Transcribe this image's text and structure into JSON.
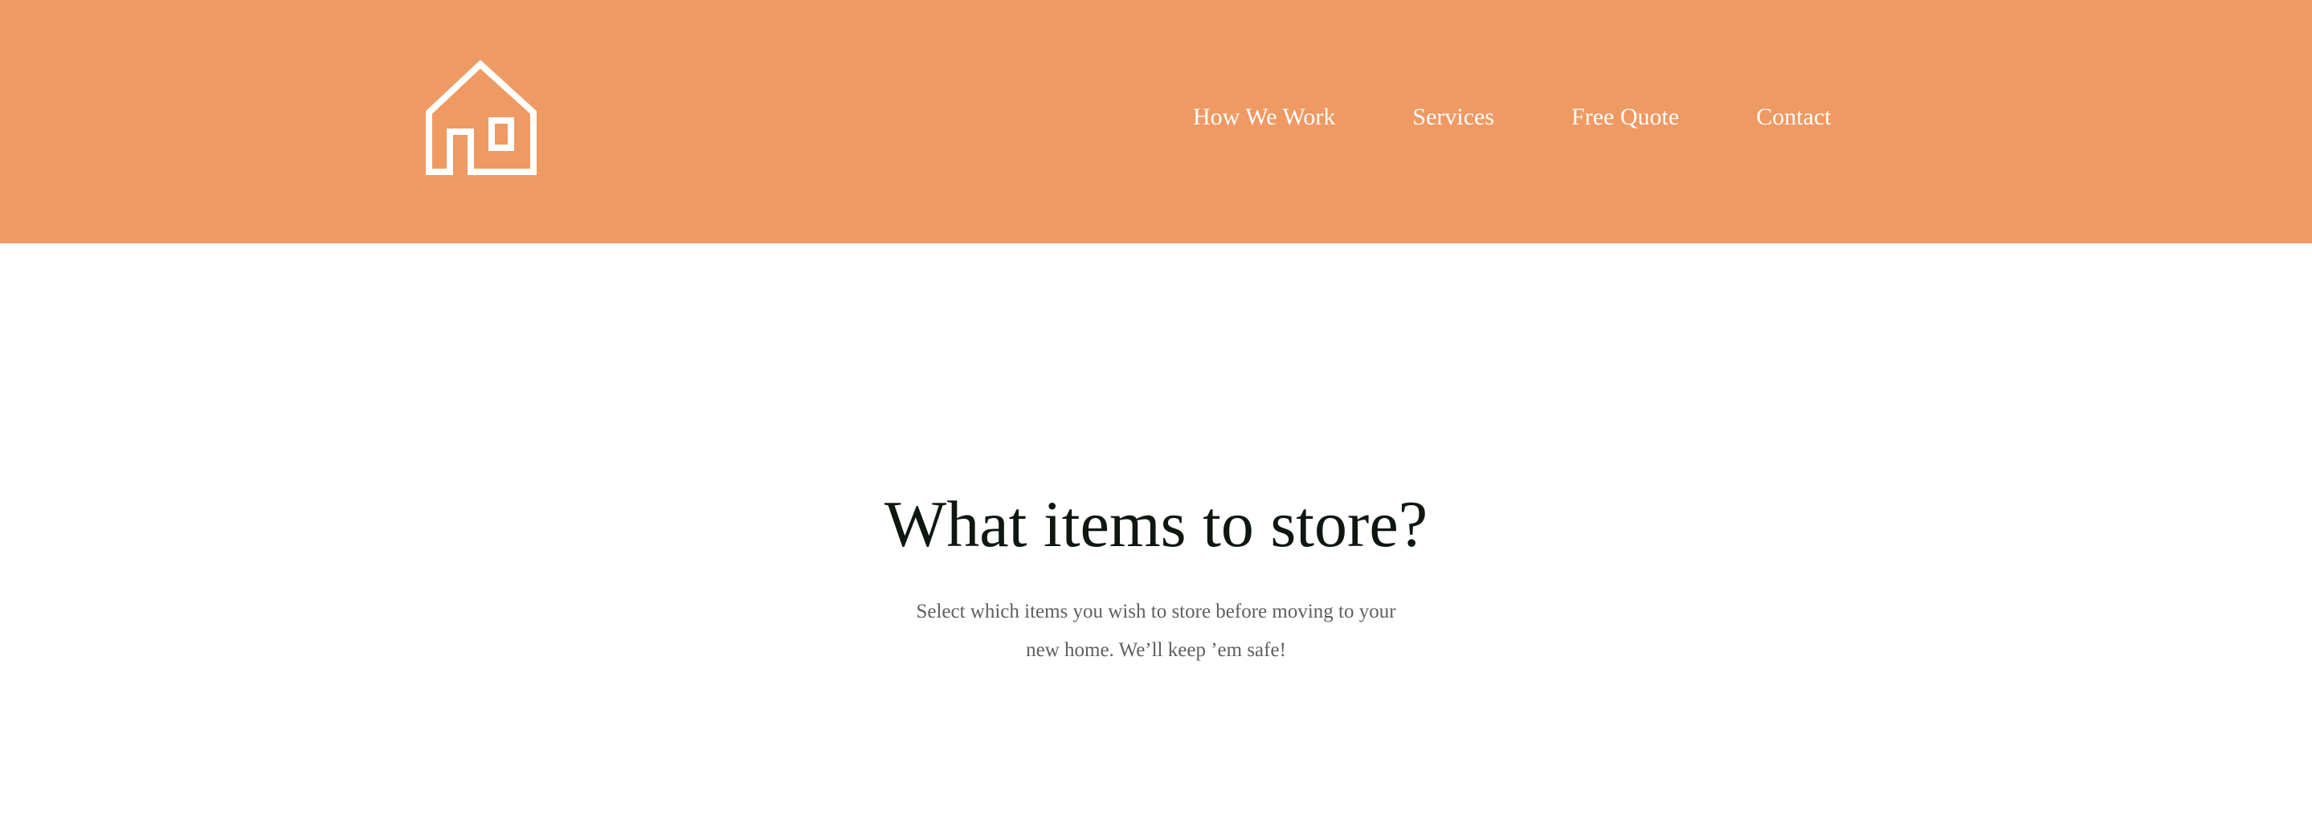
{
  "header": {
    "background_color": "#ef9963",
    "logo": {
      "icon": "house-icon"
    },
    "nav": [
      {
        "label": "How We Work"
      },
      {
        "label": "Services"
      },
      {
        "label": "Free Quote"
      },
      {
        "label": "Contact"
      }
    ]
  },
  "hero": {
    "title": "What items to store?",
    "subtitle": "Select which items you wish to store before moving to your new home. We’ll keep ’em safe!"
  }
}
